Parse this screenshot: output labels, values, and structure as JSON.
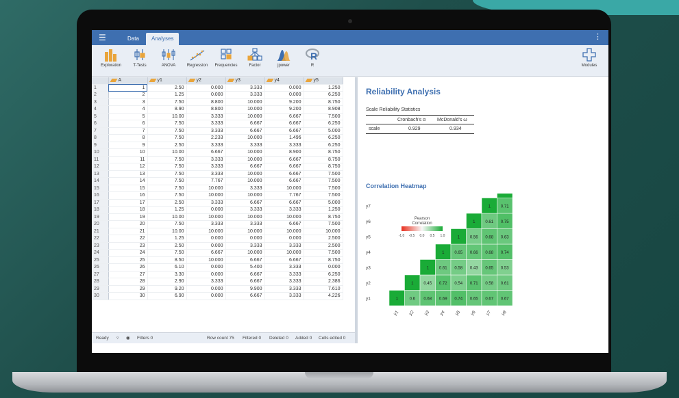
{
  "app": {
    "tabs": [
      "Data",
      "Analyses"
    ],
    "ribbon": [
      {
        "label": "Exploration",
        "icon": "exploration-icon"
      },
      {
        "label": "T-Tests",
        "icon": "ttests-icon"
      },
      {
        "label": "ANOVA",
        "icon": "anova-icon"
      },
      {
        "label": "Regression",
        "icon": "regression-icon"
      },
      {
        "label": "Frequencies",
        "icon": "frequencies-icon"
      },
      {
        "label": "Factor",
        "icon": "factor-icon"
      },
      {
        "label": "jpower",
        "icon": "jpower-icon"
      },
      {
        "label": "R",
        "icon": "r-icon"
      },
      {
        "label": "Modules",
        "icon": "modules-icon"
      }
    ],
    "colors": {
      "accent": "#3e6fb0",
      "ribbon_bg": "#e9eef5",
      "heat_high": "#1aab37",
      "heat_low": "#f2f9f3"
    }
  },
  "sheet": {
    "columns": [
      "A",
      "y1",
      "y2",
      "y3",
      "y4",
      "y5"
    ],
    "rows": [
      [
        "1",
        "2.50",
        "0.000",
        "3.333",
        "0.000",
        "1.250"
      ],
      [
        "2",
        "1.25",
        "0.000",
        "3.333",
        "0.000",
        "6.250"
      ],
      [
        "3",
        "7.50",
        "8.800",
        "10.000",
        "9.200",
        "8.750"
      ],
      [
        "4",
        "8.90",
        "8.800",
        "10.000",
        "9.200",
        "8.908"
      ],
      [
        "5",
        "10.00",
        "3.333",
        "10.000",
        "6.667",
        "7.500"
      ],
      [
        "6",
        "7.50",
        "3.333",
        "6.667",
        "6.667",
        "6.250"
      ],
      [
        "7",
        "7.50",
        "3.333",
        "6.667",
        "6.667",
        "5.000"
      ],
      [
        "8",
        "7.50",
        "2.233",
        "10.000",
        "1.496",
        "6.250"
      ],
      [
        "9",
        "2.50",
        "3.333",
        "3.333",
        "3.333",
        "6.250"
      ],
      [
        "10",
        "10.00",
        "6.667",
        "10.000",
        "8.900",
        "8.750"
      ],
      [
        "11",
        "7.50",
        "3.333",
        "10.000",
        "6.667",
        "8.750"
      ],
      [
        "12",
        "7.50",
        "3.333",
        "6.667",
        "6.667",
        "8.750"
      ],
      [
        "13",
        "7.50",
        "3.333",
        "10.000",
        "6.667",
        "7.500"
      ],
      [
        "14",
        "7.50",
        "7.767",
        "10.000",
        "6.667",
        "7.500"
      ],
      [
        "15",
        "7.50",
        "10.000",
        "3.333",
        "10.000",
        "7.500"
      ],
      [
        "16",
        "7.50",
        "10.000",
        "10.000",
        "7.767",
        "7.500"
      ],
      [
        "17",
        "2.50",
        "3.333",
        "6.667",
        "6.667",
        "5.000"
      ],
      [
        "18",
        "1.25",
        "0.000",
        "3.333",
        "3.333",
        "1.250"
      ],
      [
        "19",
        "10.00",
        "10.000",
        "10.000",
        "10.000",
        "8.750"
      ],
      [
        "20",
        "7.50",
        "3.333",
        "3.333",
        "6.667",
        "7.500"
      ],
      [
        "21",
        "10.00",
        "10.000",
        "10.000",
        "10.000",
        "10.000"
      ],
      [
        "22",
        "1.25",
        "0.000",
        "0.000",
        "0.000",
        "2.500"
      ],
      [
        "23",
        "2.50",
        "0.000",
        "3.333",
        "3.333",
        "2.500"
      ],
      [
        "24",
        "7.50",
        "6.667",
        "10.000",
        "10.000",
        "7.500"
      ],
      [
        "25",
        "8.50",
        "10.000",
        "6.667",
        "6.667",
        "8.750"
      ],
      [
        "26",
        "6.10",
        "0.000",
        "5.400",
        "3.333",
        "0.000"
      ],
      [
        "27",
        "3.30",
        "0.000",
        "6.667",
        "3.333",
        "6.250"
      ],
      [
        "28",
        "2.90",
        "3.333",
        "6.667",
        "3.333",
        "2.386"
      ],
      [
        "29",
        "9.20",
        "0.000",
        "9.900",
        "3.333",
        "7.610"
      ],
      [
        "30",
        "6.90",
        "0.000",
        "6.667",
        "3.333",
        "4.226"
      ]
    ]
  },
  "status": {
    "ready": "Ready",
    "filters": "Filters 0",
    "row_count": "Row count 75",
    "filtered": "Filtered 0",
    "deleted": "Deleted 0",
    "added": "Added 0",
    "cells_edited": "Cells edited 0"
  },
  "results": {
    "title": "Reliability Analysis",
    "table_caption": "Scale Reliability Statistics",
    "col1": "Cronbach's α",
    "col2": "McDonald's ω",
    "row_label": "scale",
    "alpha": "0.929",
    "omega": "0.934",
    "heatmap_title": "Correlation Heatmap",
    "legend_title_1": "Pearson",
    "legend_title_2": "Correlation"
  },
  "chart_data": {
    "type": "heatmap",
    "title": "Correlation Heatmap",
    "variables": [
      "y1",
      "y2",
      "y3",
      "y4",
      "y5",
      "y6",
      "y7",
      "y8"
    ],
    "legend_ticks": [
      "-1.0",
      "-0.5",
      "0.0",
      "0.5",
      "1.0"
    ],
    "legend_title": "Pearson Correlation",
    "cells": [
      {
        "row": "y1",
        "col": "y1",
        "value": "1"
      },
      {
        "row": "y1",
        "col": "y2",
        "value": "0.6"
      },
      {
        "row": "y1",
        "col": "y3",
        "value": "0.68"
      },
      {
        "row": "y1",
        "col": "y4",
        "value": "0.69"
      },
      {
        "row": "y1",
        "col": "y5",
        "value": "0.74"
      },
      {
        "row": "y1",
        "col": "y6",
        "value": "0.65"
      },
      {
        "row": "y1",
        "col": "y7",
        "value": "0.67"
      },
      {
        "row": "y1",
        "col": "y8",
        "value": "0.67"
      },
      {
        "row": "y2",
        "col": "y2",
        "value": "1"
      },
      {
        "row": "y2",
        "col": "y3",
        "value": "0.45"
      },
      {
        "row": "y2",
        "col": "y4",
        "value": "0.72"
      },
      {
        "row": "y2",
        "col": "y5",
        "value": "0.54"
      },
      {
        "row": "y2",
        "col": "y6",
        "value": "0.71"
      },
      {
        "row": "y2",
        "col": "y7",
        "value": "0.58"
      },
      {
        "row": "y2",
        "col": "y8",
        "value": "0.61"
      },
      {
        "row": "y3",
        "col": "y3",
        "value": "1"
      },
      {
        "row": "y3",
        "col": "y4",
        "value": "0.61"
      },
      {
        "row": "y3",
        "col": "y5",
        "value": "0.58"
      },
      {
        "row": "y3",
        "col": "y6",
        "value": "0.43"
      },
      {
        "row": "y3",
        "col": "y7",
        "value": "0.65"
      },
      {
        "row": "y3",
        "col": "y8",
        "value": "0.53"
      },
      {
        "row": "y4",
        "col": "y4",
        "value": "1"
      },
      {
        "row": "y4",
        "col": "y5",
        "value": "0.65"
      },
      {
        "row": "y4",
        "col": "y6",
        "value": "0.66"
      },
      {
        "row": "y4",
        "col": "y7",
        "value": "0.68"
      },
      {
        "row": "y4",
        "col": "y8",
        "value": "0.74"
      },
      {
        "row": "y5",
        "col": "y5",
        "value": "1"
      },
      {
        "row": "y5",
        "col": "y6",
        "value": "0.56"
      },
      {
        "row": "y5",
        "col": "y7",
        "value": "0.68"
      },
      {
        "row": "y5",
        "col": "y8",
        "value": "0.63"
      },
      {
        "row": "y6",
        "col": "y6",
        "value": "1"
      },
      {
        "row": "y6",
        "col": "y7",
        "value": "0.61"
      },
      {
        "row": "y6",
        "col": "y8",
        "value": "0.75"
      },
      {
        "row": "y7",
        "col": "y7",
        "value": "1"
      },
      {
        "row": "y7",
        "col": "y8",
        "value": "0.71"
      },
      {
        "row": "y8",
        "col": "y8",
        "value": "1"
      }
    ]
  }
}
